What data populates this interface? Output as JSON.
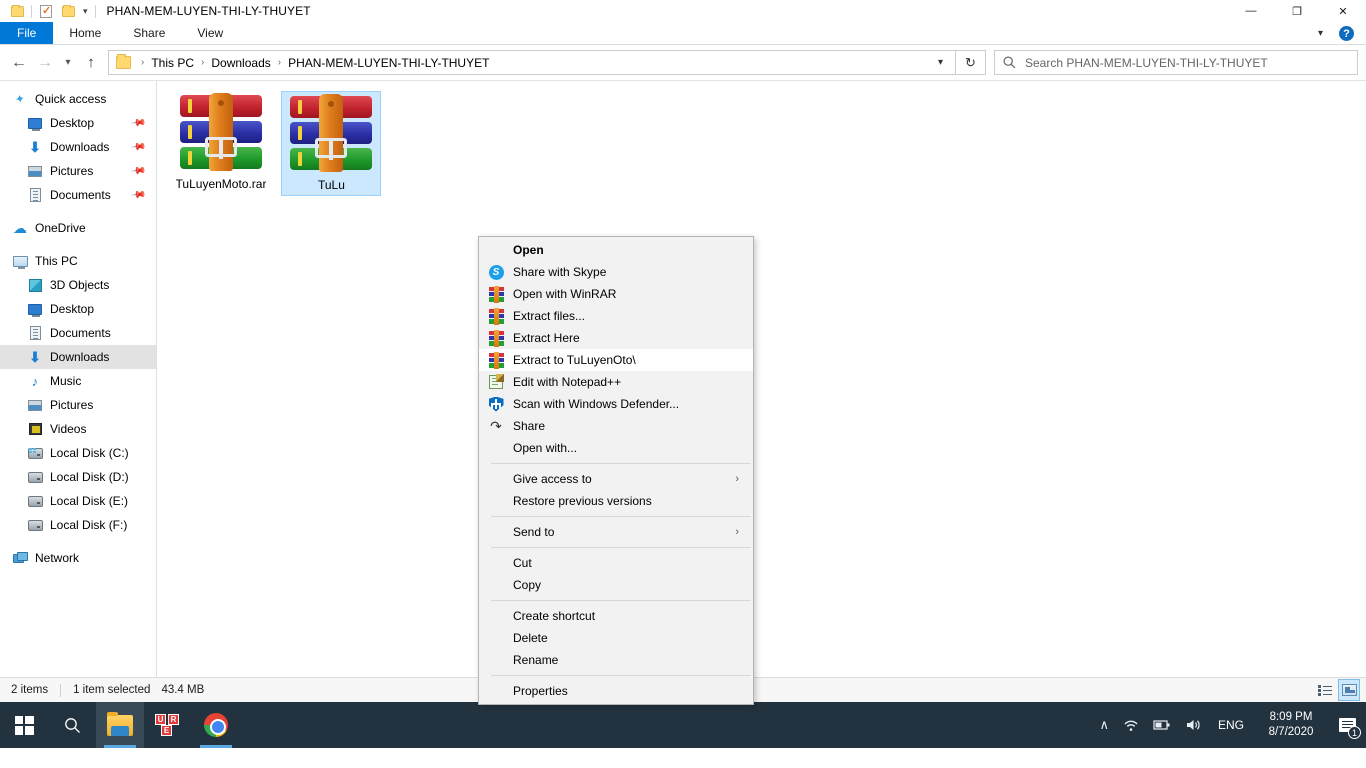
{
  "window": {
    "title": "PHAN-MEM-LUYEN-THI-LY-THUYET",
    "qat": {
      "folder_icon": "folder-icon",
      "properties_icon": "properties-checkbox-icon",
      "new_folder_icon": "new-folder-icon",
      "customize_icon": "chevron-down-icon"
    },
    "controls": {
      "minimize": "—",
      "maximize": "❐",
      "close": "✕",
      "ribbon_collapse": "⌄",
      "help": "?"
    }
  },
  "ribbon": {
    "tabs": [
      {
        "label": "File",
        "active": true
      },
      {
        "label": "Home",
        "active": false
      },
      {
        "label": "Share",
        "active": false
      },
      {
        "label": "View",
        "active": false
      }
    ]
  },
  "addressbar": {
    "back_icon": "←",
    "forward_icon": "→",
    "recent_icon": "⌄",
    "up_icon": "↑",
    "breadcrumbs": [
      "This PC",
      "Downloads",
      "PHAN-MEM-LUYEN-THI-LY-THUYET"
    ],
    "separator": "›",
    "dropdown_icon": "⌄",
    "refresh_icon": "↻"
  },
  "search": {
    "icon": "⚲",
    "placeholder": "Search PHAN-MEM-LUYEN-THI-LY-THUYET",
    "value": ""
  },
  "sidebar": {
    "groups": [
      {
        "header": {
          "label": "Quick access",
          "icon": "star-icon"
        },
        "items": [
          {
            "label": "Desktop",
            "icon": "monitor-icon",
            "pinned": true
          },
          {
            "label": "Downloads",
            "icon": "download-arrow-icon",
            "pinned": true
          },
          {
            "label": "Pictures",
            "icon": "pictures-icon",
            "pinned": true
          },
          {
            "label": "Documents",
            "icon": "documents-icon",
            "pinned": true
          }
        ]
      },
      {
        "header": {
          "label": "OneDrive",
          "icon": "cloud-icon"
        },
        "items": []
      },
      {
        "header": {
          "label": "This PC",
          "icon": "this-pc-icon"
        },
        "items": [
          {
            "label": "3D Objects",
            "icon": "3d-objects-icon",
            "pinned": false
          },
          {
            "label": "Desktop",
            "icon": "monitor-icon",
            "pinned": false
          },
          {
            "label": "Documents",
            "icon": "documents-icon",
            "pinned": false
          },
          {
            "label": "Downloads",
            "icon": "download-arrow-icon",
            "pinned": false,
            "selected": true
          },
          {
            "label": "Music",
            "icon": "music-note-icon",
            "pinned": false
          },
          {
            "label": "Pictures",
            "icon": "pictures-icon",
            "pinned": false
          },
          {
            "label": "Videos",
            "icon": "video-icon",
            "pinned": false
          },
          {
            "label": "Local Disk (C:)",
            "icon": "system-disk-icon",
            "pinned": false
          },
          {
            "label": "Local Disk (D:)",
            "icon": "disk-icon",
            "pinned": false
          },
          {
            "label": "Local Disk (E:)",
            "icon": "disk-icon",
            "pinned": false
          },
          {
            "label": "Local Disk (F:)",
            "icon": "disk-icon",
            "pinned": false
          }
        ]
      },
      {
        "header": {
          "label": "Network",
          "icon": "network-icon"
        },
        "items": []
      }
    ],
    "pin_glyph": "ὌC"
  },
  "files": [
    {
      "name": "TuLuyenMoto.rar",
      "icon": "winrar-archive-icon",
      "selected": false
    },
    {
      "name": "TuLu",
      "icon": "winrar-archive-icon",
      "selected": true
    }
  ],
  "context_menu": {
    "items": [
      {
        "label": "Open",
        "icon": "none",
        "bold": true,
        "highlight": false
      },
      {
        "label": "Share with Skype",
        "icon": "skype-icon",
        "bold": false,
        "highlight": false
      },
      {
        "label": "Open with WinRAR",
        "icon": "winrar-icon",
        "bold": false,
        "highlight": false
      },
      {
        "label": "Extract files...",
        "icon": "winrar-icon",
        "bold": false,
        "highlight": false
      },
      {
        "label": "Extract Here",
        "icon": "winrar-icon",
        "bold": false,
        "highlight": false
      },
      {
        "label": "Extract to TuLuyenOto\\",
        "icon": "winrar-icon",
        "bold": false,
        "highlight": true
      },
      {
        "label": "Edit with Notepad++",
        "icon": "notepadpp-icon",
        "bold": false,
        "highlight": false
      },
      {
        "label": "Scan with Windows Defender...",
        "icon": "shield-icon",
        "bold": false,
        "highlight": false
      },
      {
        "label": "Share",
        "icon": "share-icon",
        "bold": false,
        "highlight": false
      },
      {
        "label": "Open with...",
        "icon": "none",
        "bold": false,
        "highlight": false
      },
      {
        "separator": true
      },
      {
        "label": "Give access to",
        "icon": "none",
        "submenu": true,
        "highlight": false
      },
      {
        "label": "Restore previous versions",
        "icon": "none",
        "highlight": false
      },
      {
        "separator": true
      },
      {
        "label": "Send to",
        "icon": "none",
        "submenu": true,
        "highlight": false
      },
      {
        "separator": true
      },
      {
        "label": "Cut",
        "icon": "none",
        "highlight": false
      },
      {
        "label": "Copy",
        "icon": "none",
        "highlight": false
      },
      {
        "separator": true
      },
      {
        "label": "Create shortcut",
        "icon": "none",
        "highlight": false
      },
      {
        "label": "Delete",
        "icon": "none",
        "highlight": false
      },
      {
        "label": "Rename",
        "icon": "none",
        "highlight": false
      },
      {
        "separator": true
      },
      {
        "label": "Properties",
        "icon": "none",
        "highlight": false
      }
    ],
    "submenu_arrow": "›"
  },
  "statusbar": {
    "item_count": "2 items",
    "selection": "1 item selected",
    "size": "43.4 MB",
    "views": [
      {
        "name": "details-view",
        "active": false
      },
      {
        "name": "large-icons-view",
        "active": true
      }
    ]
  },
  "taskbar": {
    "start": "start-button",
    "search": "⚲",
    "apps": [
      {
        "name": "file-explorer",
        "active": true
      },
      {
        "name": "unikey",
        "letters": [
          "U",
          "R",
          "E"
        ]
      },
      {
        "name": "google-chrome",
        "active": true
      }
    ],
    "tray": {
      "expand": "∧",
      "wifi": "◠",
      "battery": "▮",
      "volume": "ὐA",
      "language": "ENG",
      "time": "8:09 PM",
      "date": "8/7/2020",
      "notification_count": "1"
    }
  },
  "colors": {
    "accent": "#0078d7",
    "selection": "#cce8ff",
    "taskbar": "#22323f",
    "menu_bg": "#f2f2f2"
  }
}
